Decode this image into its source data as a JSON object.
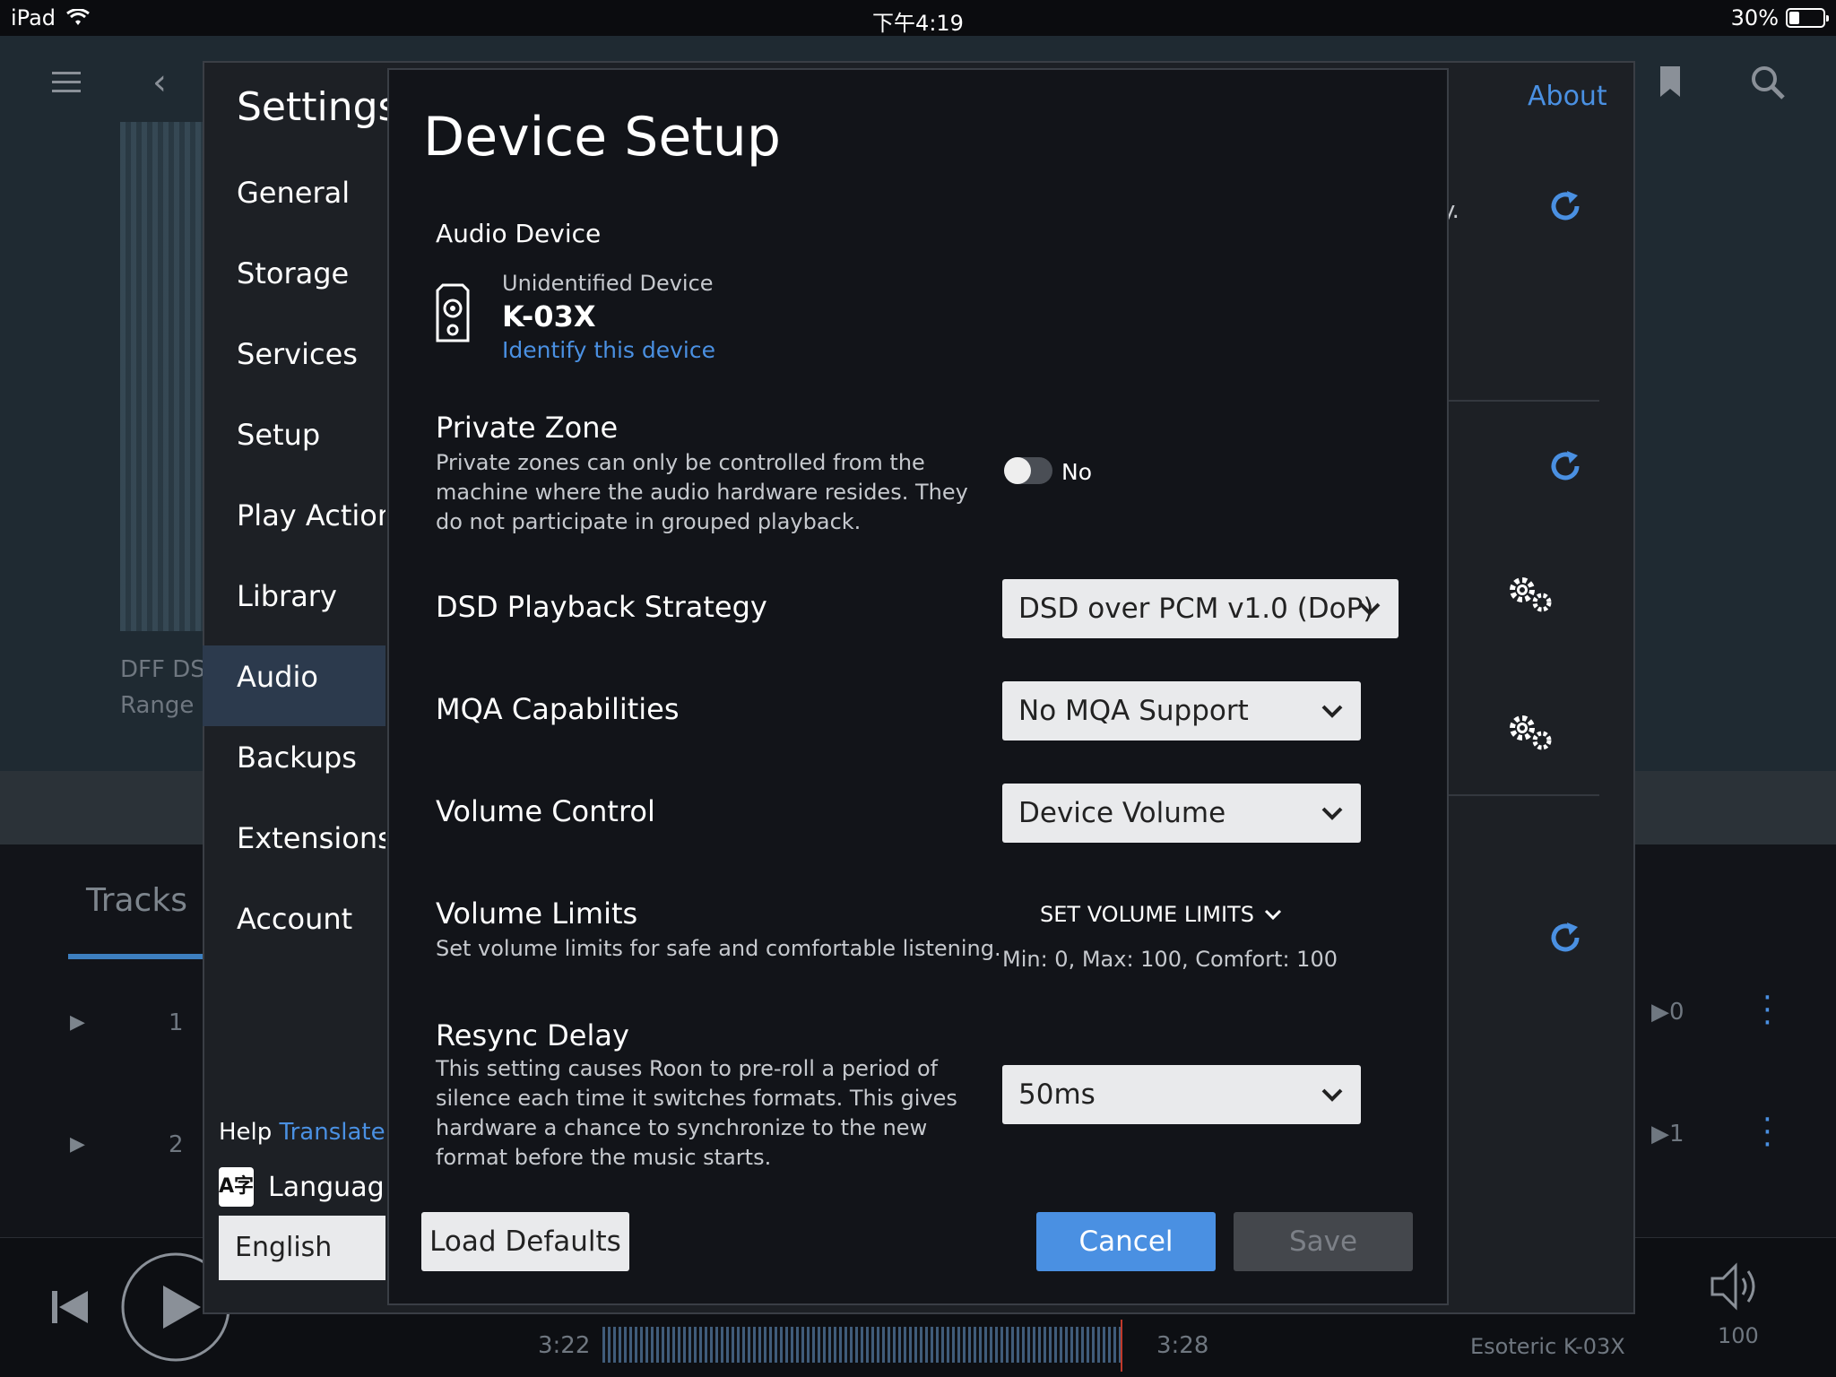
{
  "status_bar": {
    "device": "iPad",
    "time": "下午4:19",
    "battery_percent": "30%"
  },
  "background": {
    "album_meta_1": "DFF DSD",
    "album_meta_2": "Range",
    "tracks_tab": "Tracks",
    "track_rows": [
      {
        "number": "1",
        "plays": "▶0"
      },
      {
        "number": "2",
        "plays": "▶1"
      }
    ],
    "elapsed": "3:22",
    "duration": "3:28",
    "zone_name": "Esoteric K-03X",
    "volume": "100",
    "truncated_text": "y."
  },
  "settings": {
    "title": "Settings",
    "about_link": "About",
    "nav": [
      {
        "label": "General",
        "active": false
      },
      {
        "label": "Storage",
        "active": false
      },
      {
        "label": "Services",
        "active": false
      },
      {
        "label": "Setup",
        "active": false
      },
      {
        "label": "Play Actions",
        "active": false
      },
      {
        "label": "Library",
        "active": false
      },
      {
        "label": "Audio",
        "active": true
      },
      {
        "label": "Backups",
        "active": false
      },
      {
        "label": "Extensions",
        "active": false
      },
      {
        "label": "Account",
        "active": false
      }
    ],
    "help_prefix": "Help",
    "help_link": "Translate R",
    "language_label": "Language",
    "language_icon_text": "A字",
    "language_value": "English"
  },
  "modal": {
    "title": "Device Setup",
    "audio_device": {
      "heading": "Audio Device",
      "status": "Unidentified Device",
      "name": "K-03X",
      "identify_link": "Identify this device"
    },
    "private_zone": {
      "label": "Private Zone",
      "description": "Private zones can only be controlled from the machine where the audio hardware resides. They do not participate in grouped playback.",
      "toggle_value": "No"
    },
    "dsd_strategy": {
      "label": "DSD Playback Strategy",
      "value": "DSD over PCM v1.0 (DoP)"
    },
    "mqa": {
      "label": "MQA Capabilities",
      "value": "No MQA Support"
    },
    "volume_control": {
      "label": "Volume Control",
      "value": "Device Volume"
    },
    "volume_limits": {
      "label": "Volume Limits",
      "description": "Set volume limits for safe and comfortable listening.",
      "action": "SET VOLUME LIMITS",
      "summary": "Min: 0, Max: 100, Comfort: 100"
    },
    "resync_delay": {
      "label": "Resync Delay",
      "description": "This setting causes Roon to pre-roll a period of silence each time it switches formats. This gives hardware a chance to synchronize to the new format before the music starts.",
      "value": "50ms"
    },
    "buttons": {
      "load_defaults": "Load Defaults",
      "cancel": "Cancel",
      "save": "Save"
    }
  },
  "colors": {
    "accent": "#4a90e2",
    "modal_bg": "#121419",
    "select_bg": "#e9eaec",
    "active_nav": "#2c3a4d"
  }
}
